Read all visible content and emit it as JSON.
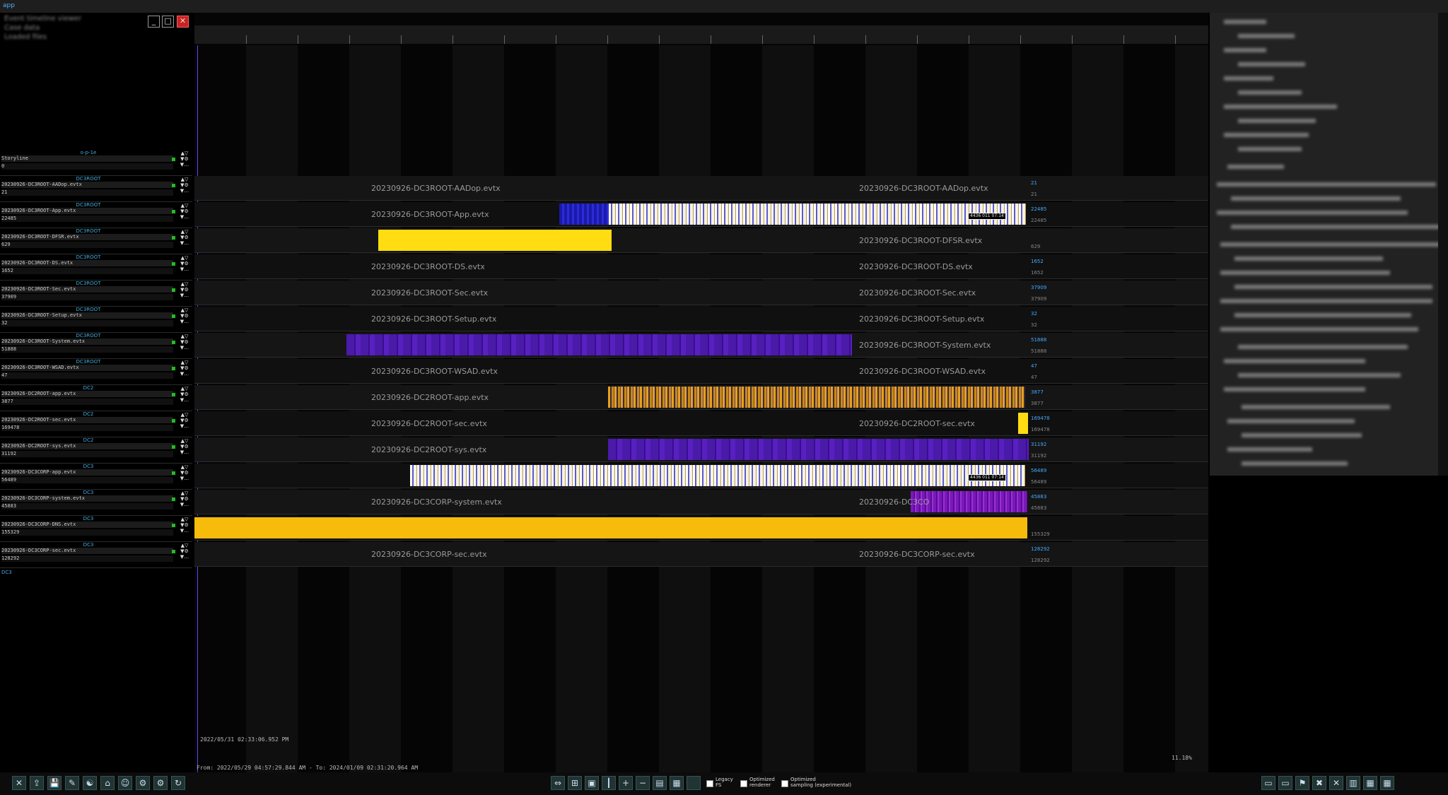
{
  "app": {
    "icon_label": "app"
  },
  "window": {
    "title_lines": [
      "Event timeline viewer",
      "Case data",
      "Loaded files"
    ],
    "minimize": "_",
    "maximize": "□",
    "close": "✕"
  },
  "tracks": [
    {
      "group": "o-p-1e",
      "name": "Storyline",
      "count": "0",
      "label": "",
      "label2": "",
      "cnt_start": "",
      "cnt_end": ""
    },
    {
      "group": "DC3ROOT",
      "name": "20230926-DC3ROOT-AADop.evtx",
      "count": "21",
      "label": "20230926-DC3ROOT-AADop.evtx",
      "label2": "20230926-DC3ROOT-AADop.evtx",
      "cnt_start": "21",
      "cnt_end": "21"
    },
    {
      "group": "DC3ROOT",
      "name": "20230926-DC3ROOT-App.evtx",
      "count": "22485",
      "label": "20230926-DC3ROOT-App.evtx",
      "label2": "",
      "cnt_start": "22485",
      "cnt_end": "22485"
    },
    {
      "group": "DC3ROOT",
      "name": "20230926-DC3ROOT-DFSR.evtx",
      "count": "629",
      "label": "",
      "label2": "20230926-DC3ROOT-DFSR.evtx",
      "cnt_start": "",
      "cnt_end": "629"
    },
    {
      "group": "DC3ROOT",
      "name": "20230926-DC3ROOT-DS.evtx",
      "count": "1652",
      "label": "20230926-DC3ROOT-DS.evtx",
      "label2": "20230926-DC3ROOT-DS.evtx",
      "cnt_start": "1652",
      "cnt_end": "1652"
    },
    {
      "group": "DC3ROOT",
      "name": "20230926-DC3ROOT-Sec.evtx",
      "count": "37909",
      "label": "20230926-DC3ROOT-Sec.evtx",
      "label2": "20230926-DC3ROOT-Sec.evtx",
      "cnt_start": "37909",
      "cnt_end": "37909"
    },
    {
      "group": "DC3ROOT",
      "name": "20230926-DC3ROOT-Setup.evtx",
      "count": "32",
      "label": "20230926-DC3ROOT-Setup.evtx",
      "label2": "20230926-DC3ROOT-Setup.evtx",
      "cnt_start": "32",
      "cnt_end": "32"
    },
    {
      "group": "DC3ROOT",
      "name": "20230926-DC3ROOT-System.evtx",
      "count": "51888",
      "label": "",
      "label2": "20230926-DC3ROOT-System.evtx",
      "cnt_start": "51888",
      "cnt_end": "51888"
    },
    {
      "group": "DC3ROOT",
      "name": "20230926-DC3ROOT-WSAD.evtx",
      "count": "47",
      "label": "20230926-DC3ROOT-WSAD.evtx",
      "label2": "20230926-DC3ROOT-WSAD.evtx",
      "cnt_start": "47",
      "cnt_end": "47"
    },
    {
      "group": "DC2",
      "name": "20230926-DC2ROOT-app.evtx",
      "count": "3877",
      "label": "20230926-DC2ROOT-app.evtx",
      "label2": "",
      "cnt_start": "3877",
      "cnt_end": "3877"
    },
    {
      "group": "DC2",
      "name": "20230926-DC2ROOT-sec.evtx",
      "count": "169478",
      "label": "20230926-DC2ROOT-sec.evtx",
      "label2": "20230926-DC2ROOT-sec.evtx",
      "cnt_start": "169478",
      "cnt_end": "169478"
    },
    {
      "group": "DC2",
      "name": "20230926-DC2ROOT-sys.evtx",
      "count": "31192",
      "label": "20230926-DC2ROOT-sys.evtx",
      "label2": "",
      "cnt_start": "31192",
      "cnt_end": "31192"
    },
    {
      "group": "DC3",
      "name": "20230926-DC3CORP-app.evtx",
      "count": "56489",
      "label": "",
      "label2": "",
      "cnt_start": "56489",
      "cnt_end": "56489"
    },
    {
      "group": "DC3",
      "name": "20230926-DC3CORP-system.evtx",
      "count": "45883",
      "label": "20230926-DC3CORP-system.evtx",
      "label2": "20230926-DC3CO",
      "cnt_start": "45883",
      "cnt_end": "45883"
    },
    {
      "group": "DC3",
      "name": "20230926-DC3CORP-DNS.evtx",
      "count": "155329",
      "label": "",
      "label2": "",
      "cnt_start": "",
      "cnt_end": "155329"
    },
    {
      "group": "DC3",
      "name": "20230926-DC3CORP-sec.evtx",
      "count": "128292",
      "label": "20230926-DC3CORP-sec.evtx",
      "label2": "20230926-DC3CORP-sec.evtx",
      "cnt_start": "128292",
      "cnt_end": "128292"
    }
  ],
  "left_footer": "DC3",
  "timeline": {
    "cursor_time": "2022/05/31 02:33:06.952 PM",
    "range_text": "From: 2022/05/29 04:57:29.844 AM - To: 2024/01/09 02:31:20.964 AM",
    "zoom_text": "11.18%",
    "tag_app": "4436 011 07:14 ",
    "tag_corp": "4436 011 07:14 "
  },
  "toolbar": {
    "left_buttons": [
      "close-icon",
      "export-icon",
      "save-icon",
      "edit-icon",
      "filter-icon",
      "bookmark-icon",
      "user-icon",
      "settings-icon",
      "gear-icon",
      "sync-icon"
    ],
    "center_buttons": [
      "fit-icon",
      "zoom-region-icon",
      "snapshot-icon",
      "marker-icon",
      "add-icon",
      "remove-icon",
      "chart-icon",
      "heatmap-icon",
      "blank-icon"
    ],
    "legacy_label": "Legacy\nFS",
    "optimized_label": "Optimized\nrenderer",
    "sampling_label": "Optimized\nsampling (experimental)",
    "right_buttons": [
      "chat-icon",
      "monitor-icon",
      "tag-icon",
      "pin-icon",
      "close-icon",
      "layout-icon",
      "table-icon",
      "grid-icon"
    ]
  },
  "colors": {
    "cursor": "#6a3cff",
    "accent_blue": "#44aaff",
    "yellow": "#ffdd11",
    "amber": "#f7bb0c",
    "purple": "#4a1aa8"
  }
}
